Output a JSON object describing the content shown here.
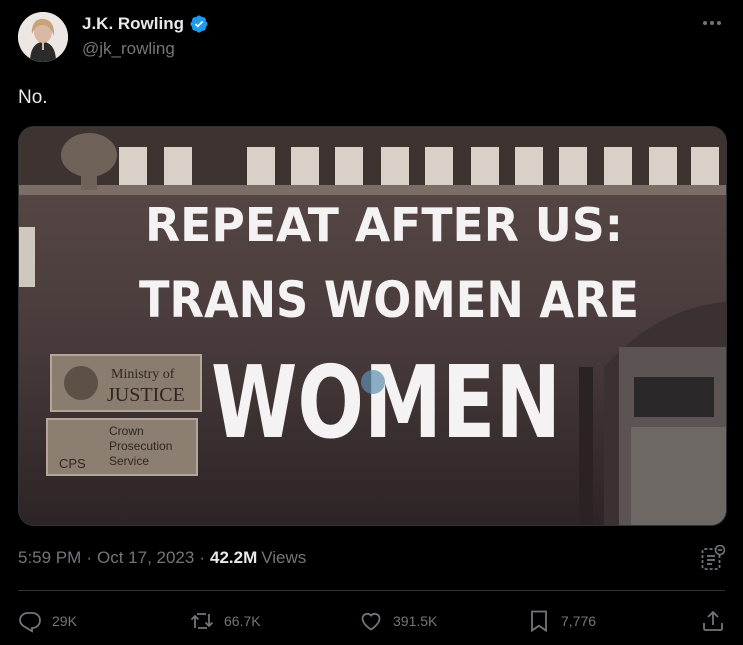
{
  "author": {
    "display_name": "J.K. Rowling",
    "handle": "@jk_rowling",
    "verified_color": "#1d9bf0"
  },
  "tweet": {
    "text": "No."
  },
  "media": {
    "projection_lines": [
      "REPEAT AFTER US:",
      "TRANS WOMEN ARE",
      "WOMEN"
    ],
    "plaque_ministry": [
      "Ministry of",
      "JUSTICE"
    ],
    "plaque_cps": [
      "Crown",
      "Prosecution",
      "Service",
      "CPS"
    ]
  },
  "meta": {
    "time": "5:59 PM",
    "date": "Oct 17, 2023",
    "views_count": "42.2M",
    "views_label": "Views"
  },
  "actions": {
    "replies": "29K",
    "reposts": "66.7K",
    "likes": "391.5K",
    "bookmarks": "7,776"
  },
  "icons": [
    "more-icon",
    "verified-badge-icon",
    "analytics-icon",
    "reply-icon",
    "repost-icon",
    "like-icon",
    "bookmark-icon",
    "share-icon"
  ]
}
